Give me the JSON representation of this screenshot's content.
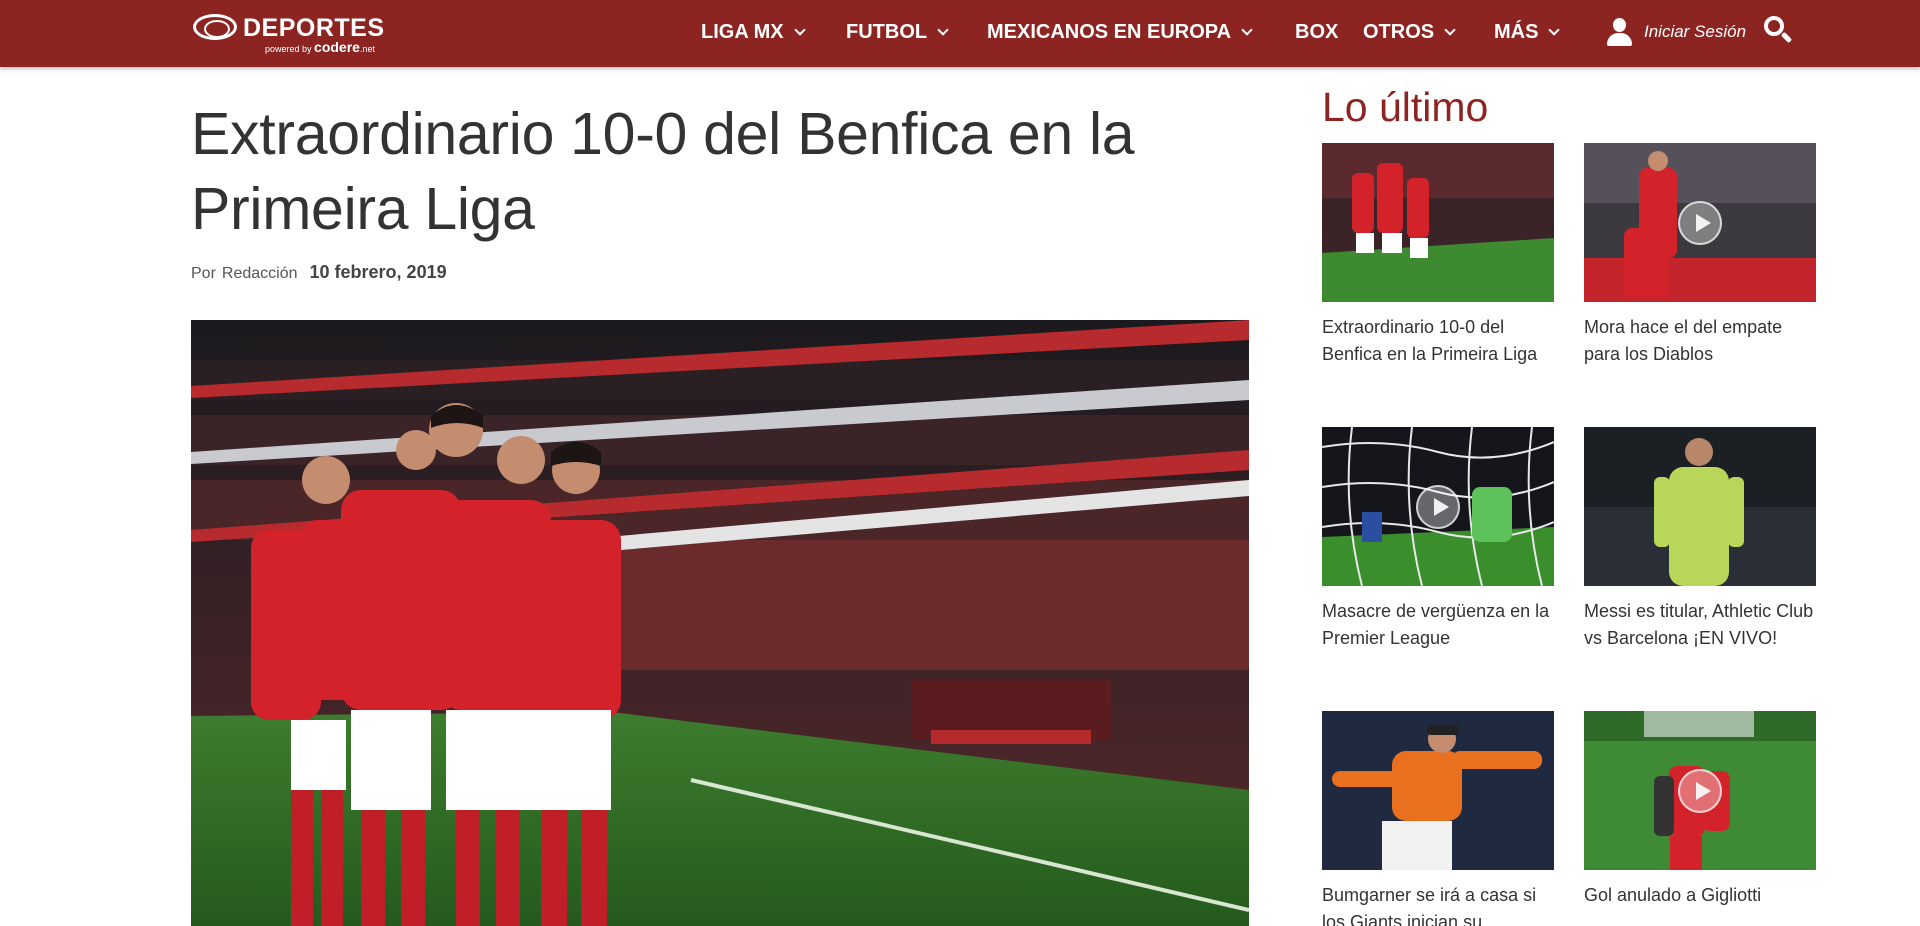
{
  "brand": {
    "name": "DEPORTES",
    "powered_by": "powered by",
    "sponsor": "codere",
    "sponsor_suffix": ".net"
  },
  "nav": {
    "items": [
      {
        "label": "LIGA MX",
        "dropdown": true
      },
      {
        "label": "FUTBOL",
        "dropdown": true
      },
      {
        "label": "MEXICANOS EN EUROPA",
        "dropdown": true
      },
      {
        "label": "BOX",
        "dropdown": false
      },
      {
        "label": "OTROS",
        "dropdown": true
      },
      {
        "label": "MÁS",
        "dropdown": true
      }
    ],
    "login_label": "Iniciar Sesión",
    "user_icon": "user-icon",
    "search_icon": "search-icon"
  },
  "article": {
    "title": "Extraordinario 10-0 del Benfica en la Primeira Liga",
    "by_label": "Por",
    "author": "Redacción",
    "date": "10 febrero, 2019"
  },
  "sidebar": {
    "title": "Lo último",
    "cards": [
      {
        "title": "Extraordinario 10-0 del Benfica en la Primeira Liga",
        "video": false
      },
      {
        "title": "Mora hace el del empate para los Diablos",
        "video": true
      },
      {
        "title": "Masacre de vergüenza en la Premier League",
        "video": true
      },
      {
        "title": "Messi es titular, Athletic Club vs Barcelona ¡EN VIVO!",
        "video": false
      },
      {
        "title": "Bumgarner se irá a casa si los Giants inician su",
        "video": false
      },
      {
        "title": "Gol anulado a Gigliotti",
        "video": true
      }
    ]
  },
  "colors": {
    "brand_red": "#8c2522",
    "text": "#333333"
  }
}
